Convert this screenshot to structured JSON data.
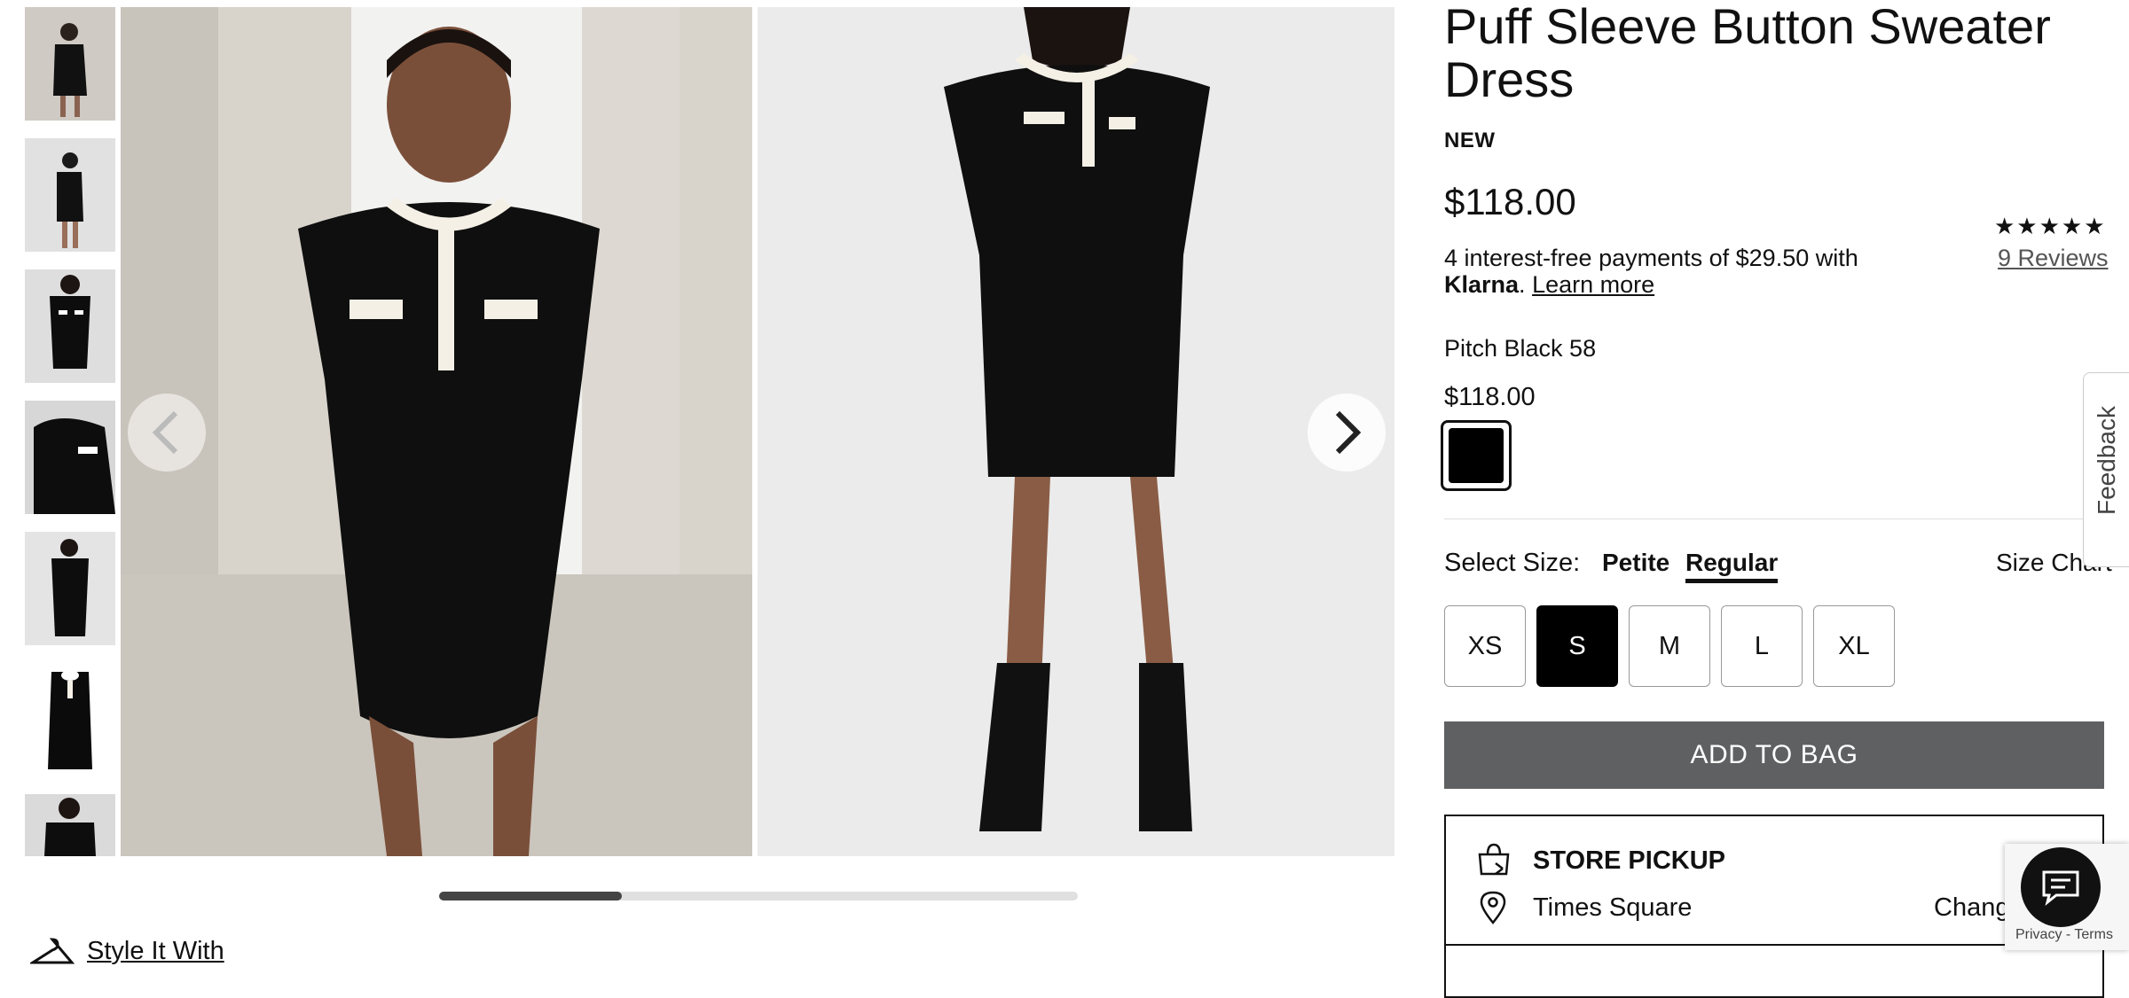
{
  "product": {
    "title": "Puff Sleeve Button Sweater Dress",
    "badge": "NEW",
    "price": "$118.00",
    "klarna_text": "4 interest-free payments of $29.50 with",
    "klarna_brand": "Klarna",
    "klarna_link": "Learn more",
    "rating_stars": "★★★★★",
    "reviews_label": "9 Reviews",
    "color_name": "Pitch Black 58",
    "color_price": "$118.00",
    "swatch_color": "#000000"
  },
  "size": {
    "label": "Select Size:",
    "tabs": [
      "Petite",
      "Regular"
    ],
    "active_tab": "Regular",
    "chart_label": "Size Chart",
    "options": [
      "XS",
      "S",
      "M",
      "L",
      "XL"
    ],
    "selected": "S"
  },
  "actions": {
    "add_to_bag": "ADD TO BAG"
  },
  "pickup": {
    "title": "STORE PICKUP",
    "store": "Times Square",
    "change_label": "Change"
  },
  "gallery": {
    "style_link": "Style It With",
    "thumbnail_count": 7,
    "carousel_progress": 0.29
  },
  "widgets": {
    "feedback_label": "Feedback",
    "recaptcha_text": "Privacy - Terms"
  },
  "colors": {
    "accent": "#000000",
    "button_gray": "#5f6061"
  }
}
